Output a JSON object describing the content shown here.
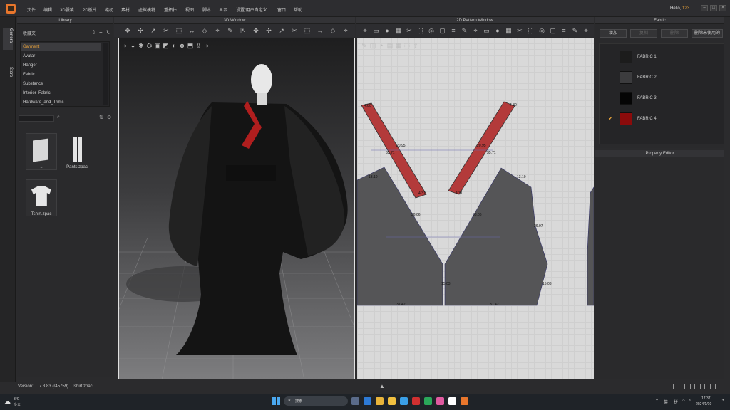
{
  "menu": [
    "文件",
    "编辑",
    "3D服装",
    "2D板片",
    "缝纫",
    "素材",
    "虚拟模特",
    "重拓扑",
    "视图",
    "脚本",
    "显示",
    "设置/用户自定义",
    "窗口",
    "帮助"
  ],
  "hello": {
    "prefix": "Hello,",
    "user": "123"
  },
  "sidetabs": {
    "general": "General",
    "store": "Store"
  },
  "library": {
    "title": "Library",
    "path": "收藏夹",
    "items": [
      "Garment",
      "Avatar",
      "Hanger",
      "Fabric",
      "Substance",
      "Interior_Fabric",
      "Hardware_and_Trims"
    ],
    "selected": "Garment",
    "thumbs": [
      "..",
      "Pants.zpac",
      "Tshirt.zpac"
    ]
  },
  "window3d": {
    "title": "3D Window"
  },
  "window2d": {
    "title": "2D Pattern Window",
    "measures": [
      "4.80",
      "4.80",
      "20.95",
      "20.95",
      "35.71",
      "35.71",
      "13.10",
      "13.10",
      "4.31",
      "4.31",
      "38.06",
      "38.06",
      "26.97",
      "15.03",
      "15.03",
      "31.42",
      "31.42"
    ]
  },
  "fabric": {
    "title": "Fabric",
    "buttons": [
      "增加",
      "复制",
      "删除",
      "删除未使用的"
    ],
    "items": [
      {
        "name": "FABRIC 1",
        "color": "#1c1c1c",
        "checked": false
      },
      {
        "name": "FABRIC 2",
        "color": "#3c3c3e",
        "checked": false
      },
      {
        "name": "FABRIC 3",
        "color": "#050505",
        "checked": false
      },
      {
        "name": "FABRIC 4",
        "color": "#8b0b0b",
        "checked": true
      }
    ]
  },
  "property": {
    "title": "Property Editor"
  },
  "status": {
    "version_label": "Version:",
    "version": "7.3.83 (r45759)",
    "file": "Tshirt.zpac"
  },
  "taskbar": {
    "temp": "3°C",
    "weather": "多云",
    "search": "搜索",
    "lang1": "英",
    "lang2": "拼",
    "time": "17:37",
    "date": "2024/1/10"
  },
  "colors": {
    "accent": "#e8a23a",
    "pattern_red": "#b33a3a",
    "pattern_gray": "#555557"
  }
}
